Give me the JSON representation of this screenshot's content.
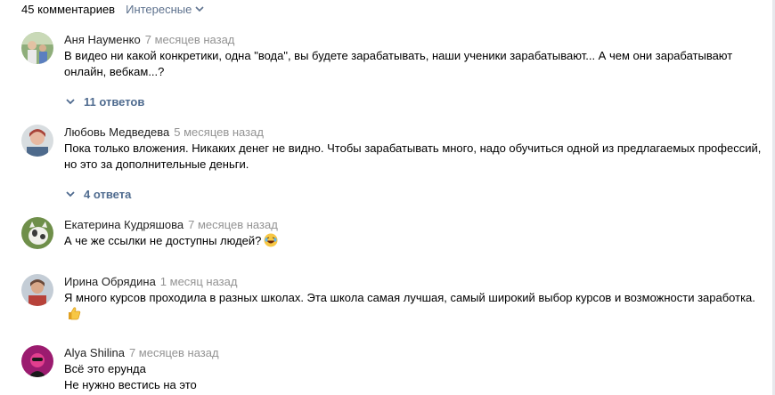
{
  "header": {
    "comments_count": "45 комментариев",
    "sort_label": "Интересные",
    "sort_icon": "chevron-down-icon"
  },
  "colors": {
    "link": "#5e728e",
    "time": "#939393",
    "accent": "#4f6b8f"
  },
  "comments": [
    {
      "author": "Аня Науменко",
      "time": "7 месяцев назад",
      "text": "В видео ни какой конкретики, одна \"вода\", вы будете зарабатывать, наши ученики зарабатывают... А чем они зарабатывают онлайн, вебкам...?",
      "replies": "11 ответов"
    },
    {
      "author": "Любовь Медведева",
      "time": "5 месяцев назад",
      "text": "Пока только вложения. Никаких денег не видно. Чтобы зарабатывать много, надо обучиться одной из предлагаемых профессий, но это за дополнительные деньги.",
      "replies": "4 ответа"
    },
    {
      "author": "Екатерина Кудряшова",
      "time": "7 месяцев назад",
      "text": "А че же ссылки не доступны людей?",
      "emoji": "laughing-face-icon"
    },
    {
      "author": "Ирина Обрядина",
      "time": "1 месяц назад",
      "text": "Я много курсов проходила в разных школах. Эта школа самая лучшая, самый широкий выбор курсов и возможности заработка.",
      "emoji": "thumbs-up-icon"
    },
    {
      "author": "Alya Shilina",
      "time": "7 месяцев назад",
      "text_line1": "Всё это ерунда",
      "text_line2": "Не нужно вестись на это"
    }
  ]
}
